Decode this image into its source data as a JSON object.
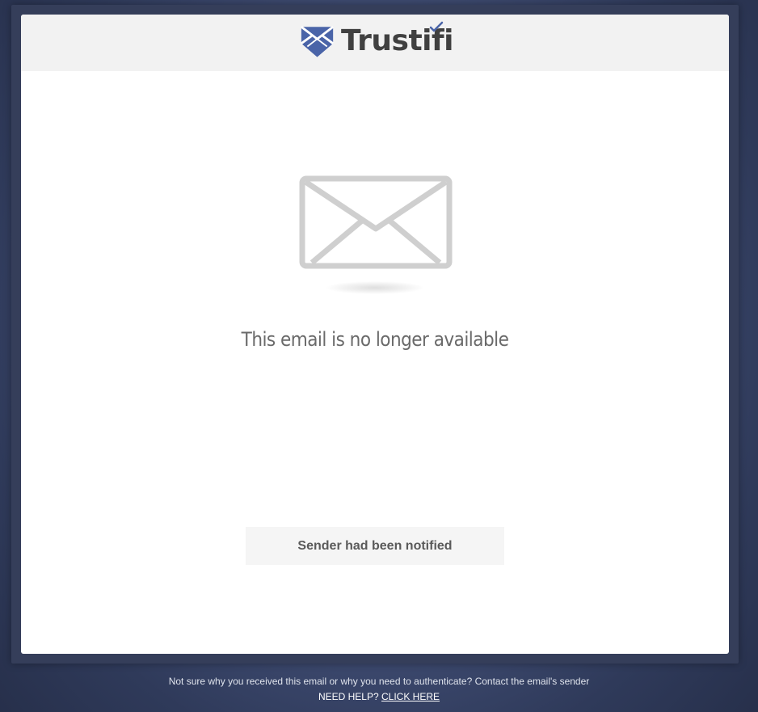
{
  "brand": {
    "name": "Trustifi",
    "logo_icon": "trustifi-shield-envelope-icon",
    "logo_color": "#4a64a8",
    "check_color": "#4a64a8"
  },
  "main": {
    "envelope_icon": "envelope-icon",
    "envelope_color": "#cfcfcf",
    "message": "This email is no longer available",
    "notice": "Sender had been notified"
  },
  "footer": {
    "info_text": "Not sure why you received this email or why you need to authenticate? Contact the email's sender",
    "help_label": "NEED HELP?",
    "help_link": "CLICK HERE"
  }
}
